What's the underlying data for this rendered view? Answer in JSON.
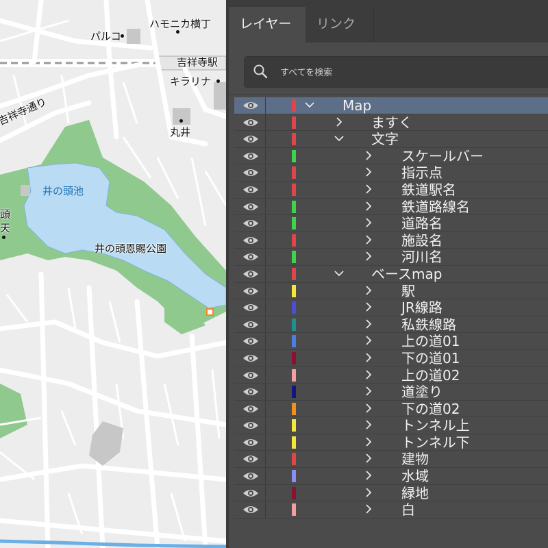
{
  "map": {
    "labels": {
      "harmonica": "ハモニカ横丁",
      "parco": "パルコ",
      "kichijoji_station": "吉祥寺駅",
      "kirarina": "キラリナ",
      "kichijoji_street": "吉祥寺通り",
      "marui": "丸井",
      "inokashira_pond": "井の頭池",
      "inokashira_park": "井の頭恩賜公園",
      "benzaiten_top": "頭",
      "benzaiten_bottom": "天"
    },
    "colors": {
      "background": "#ededed",
      "road": "#ffffff",
      "park": "#8fc98e",
      "water": "#b9dcf4",
      "building": "#c7c7c7",
      "railway": "#9a9a9a"
    }
  },
  "panel": {
    "tabs": [
      {
        "label": "レイヤー",
        "active": true
      },
      {
        "label": "リンク",
        "active": false
      }
    ],
    "search": {
      "placeholder": "すべてを検索",
      "icon": "search-icon"
    },
    "layers": [
      {
        "name": "Map",
        "color": "#e0454b",
        "depth": 0,
        "expanded": true,
        "selected": true
      },
      {
        "name": "ますく",
        "color": "#e0454b",
        "depth": 1,
        "expanded": false
      },
      {
        "name": "文字",
        "color": "#e0454b",
        "depth": 1,
        "expanded": true
      },
      {
        "name": "スケールバー",
        "color": "#3ed34a",
        "depth": 2,
        "expanded": false
      },
      {
        "name": "指示点",
        "color": "#e0454b",
        "depth": 2,
        "expanded": false
      },
      {
        "name": "鉄道駅名",
        "color": "#e0454b",
        "depth": 2,
        "expanded": false
      },
      {
        "name": "鉄道路線名",
        "color": "#3ed34a",
        "depth": 2,
        "expanded": false
      },
      {
        "name": "道路名",
        "color": "#3ed34a",
        "depth": 2,
        "expanded": false
      },
      {
        "name": "施設名",
        "color": "#e0454b",
        "depth": 2,
        "expanded": false
      },
      {
        "name": "河川名",
        "color": "#3ed34a",
        "depth": 2,
        "expanded": false
      },
      {
        "name": "ベースmap",
        "color": "#e0454b",
        "depth": 1,
        "expanded": true
      },
      {
        "name": "駅",
        "color": "#f4e73a",
        "depth": 2,
        "expanded": false
      },
      {
        "name": "JR線路",
        "color": "#4a4fd6",
        "depth": 2,
        "expanded": false
      },
      {
        "name": "私鉄線路",
        "color": "#1f8f8f",
        "depth": 2,
        "expanded": false
      },
      {
        "name": "上の道01",
        "color": "#4a7fe0",
        "depth": 2,
        "expanded": false
      },
      {
        "name": "下の道01",
        "color": "#8e1030",
        "depth": 2,
        "expanded": false
      },
      {
        "name": "上の道02",
        "color": "#f0a0a0",
        "depth": 2,
        "expanded": false
      },
      {
        "name": "道塗り",
        "color": "#14147a",
        "depth": 2,
        "expanded": false
      },
      {
        "name": "下の道02",
        "color": "#f0901e",
        "depth": 2,
        "expanded": false
      },
      {
        "name": "トンネル上",
        "color": "#f4e73a",
        "depth": 2,
        "expanded": false
      },
      {
        "name": "トンネル下",
        "color": "#f4e73a",
        "depth": 2,
        "expanded": false
      },
      {
        "name": "建物",
        "color": "#e0454b",
        "depth": 2,
        "expanded": false
      },
      {
        "name": "水域",
        "color": "#8a8ef0",
        "depth": 2,
        "expanded": false
      },
      {
        "name": "緑地",
        "color": "#8e1030",
        "depth": 2,
        "expanded": false
      },
      {
        "name": "白",
        "color": "#f0a0a0",
        "depth": 2,
        "expanded": false
      }
    ]
  }
}
